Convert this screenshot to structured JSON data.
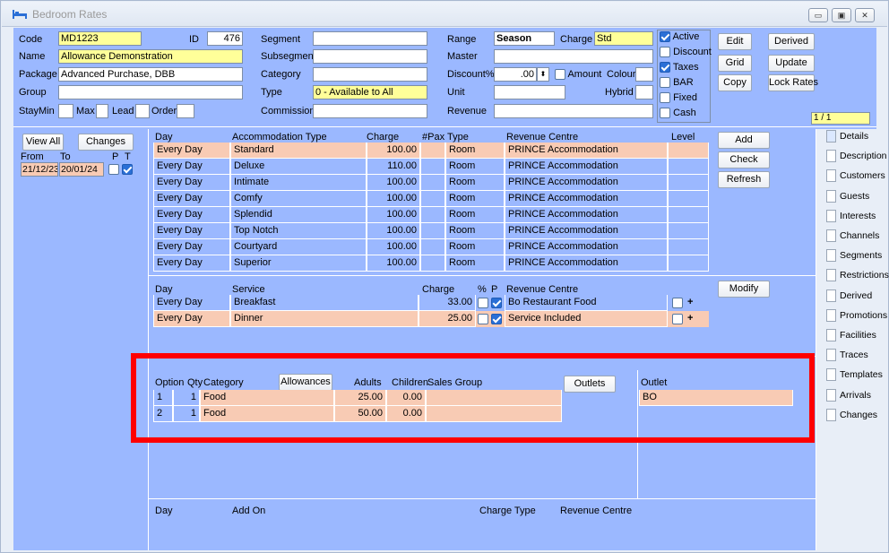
{
  "window": {
    "title": "Bedroom Rates"
  },
  "header": {
    "code_label": "Code",
    "code_value": "MD1223",
    "id_label": "ID",
    "id_value": "476",
    "name_label": "Name",
    "name_value": "Allowance Demonstration",
    "package_label": "Package",
    "package_value": "Advanced Purchase, DBB",
    "group_label": "Group",
    "group_value": "",
    "staymin_label": "StayMin",
    "max_label": "Max",
    "lead_label": "Lead",
    "order_label": "Order",
    "segment_label": "Segment",
    "subsegment_label": "Subsegment",
    "category_label": "Category",
    "type_label": "Type",
    "type_value": "0 - Available to All",
    "commission_label": "Commission",
    "range_label": "Range",
    "range_value": "Season",
    "charge_label": "Charge",
    "charge_value": "Std",
    "master_label": "Master",
    "discount_label": "Discount%",
    "discount_value": ".00",
    "amount_label": "Amount",
    "colour_label": "Colour",
    "unit_label": "Unit",
    "hybrid_label": "Hybrid",
    "revenue_label": "Revenue",
    "checks": {
      "active": "Active",
      "discount": "Discount",
      "taxes": "Taxes",
      "bar": "BAR",
      "fixed": "Fixed",
      "cash": "Cash"
    },
    "buttons": {
      "edit": "Edit",
      "derived": "Derived",
      "grid": "Grid",
      "update": "Update",
      "copy": "Copy",
      "lock_rates": "Lock Rates"
    },
    "page_indicator": "1 / 1"
  },
  "left": {
    "view_all": "View All",
    "changes": "Changes",
    "from_label": "From",
    "to_label": "To",
    "p_label": "P",
    "t_label": "T",
    "from": "21/12/23",
    "to": "20/01/24"
  },
  "accom": {
    "headers": {
      "day": "Day",
      "type": "Accommodation Type",
      "charge": "Charge",
      "pax": "#Pax",
      "rtype": "Type",
      "rc": "Revenue Centre",
      "level": "Level"
    },
    "rows": [
      {
        "day": "Every Day",
        "type": "Standard",
        "charge": "100.00",
        "rtype": "Room",
        "rc": "PRINCE Accommodation"
      },
      {
        "day": "Every Day",
        "type": "Deluxe",
        "charge": "110.00",
        "rtype": "Room",
        "rc": "PRINCE Accommodation"
      },
      {
        "day": "Every Day",
        "type": "Intimate",
        "charge": "100.00",
        "rtype": "Room",
        "rc": "PRINCE Accommodation"
      },
      {
        "day": "Every Day",
        "type": "Comfy",
        "charge": "100.00",
        "rtype": "Room",
        "rc": "PRINCE Accommodation"
      },
      {
        "day": "Every Day",
        "type": "Splendid",
        "charge": "100.00",
        "rtype": "Room",
        "rc": "PRINCE Accommodation"
      },
      {
        "day": "Every Day",
        "type": "Top Notch",
        "charge": "100.00",
        "rtype": "Room",
        "rc": "PRINCE Accommodation"
      },
      {
        "day": "Every Day",
        "type": "Courtyard",
        "charge": "100.00",
        "rtype": "Room",
        "rc": "PRINCE Accommodation"
      },
      {
        "day": "Every Day",
        "type": "Superior",
        "charge": "100.00",
        "rtype": "Room",
        "rc": "PRINCE Accommodation"
      }
    ],
    "buttons": {
      "add": "Add",
      "check": "Check",
      "refresh": "Refresh"
    }
  },
  "service": {
    "headers": {
      "day": "Day",
      "service": "Service",
      "charge": "Charge",
      "pct": "%",
      "p": "P",
      "rc": "Revenue Centre"
    },
    "rows": [
      {
        "day": "Every Day",
        "service": "Breakfast",
        "charge": "33.00",
        "rc": "Bo Restaurant Food",
        "plus": "+"
      },
      {
        "day": "Every Day",
        "service": "Dinner",
        "charge": "25.00",
        "rc": "Service Included",
        "plus": "+"
      }
    ],
    "modify": "Modify"
  },
  "allowances": {
    "headers": {
      "option": "Option",
      "qty": "Qty",
      "category": "Category",
      "adults": "Adults",
      "children": "Children",
      "sales_group": "Sales Group",
      "outlet": "Outlet"
    },
    "allowances_button": "Allowances",
    "outlets_button": "Outlets",
    "rows": [
      {
        "option": "1",
        "qty": "1",
        "category": "Food",
        "adults": "25.00",
        "children": "0.00"
      },
      {
        "option": "2",
        "qty": "1",
        "category": "Food",
        "adults": "50.00",
        "children": "0.00"
      }
    ],
    "outlet_rows": [
      "BO"
    ]
  },
  "addon": {
    "headers": {
      "day": "Day",
      "addon": "Add On",
      "charge_type": "Charge Type",
      "rc": "Revenue Centre"
    }
  },
  "tabs": [
    "Details",
    "Description",
    "Customers",
    "Guests",
    "Interests",
    "Channels",
    "Segments",
    "Restrictions",
    "Derived",
    "Promotions",
    "Facilities",
    "Traces",
    "Templates",
    "Arrivals",
    "Changes"
  ],
  "colors": {
    "panel": "#9bb8ff",
    "highlight": "#f8cbb4",
    "yellow": "#ffff99",
    "annotation": "#ff0000"
  }
}
